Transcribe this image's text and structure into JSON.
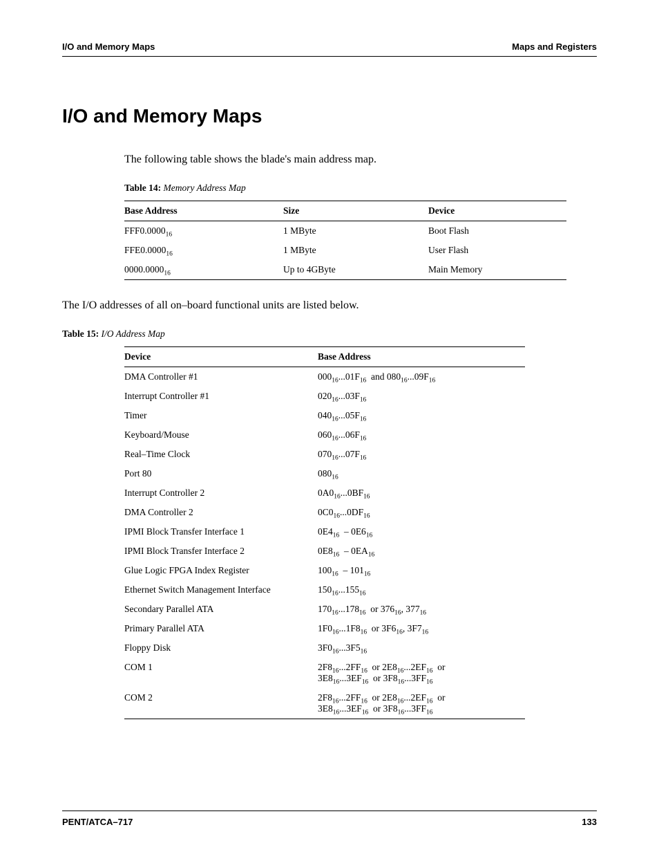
{
  "header": {
    "left": "I/O and Memory Maps",
    "right": "Maps and Registers"
  },
  "title": "I/O and Memory Maps",
  "intro1": "The following table shows the blade's main address map.",
  "table14": {
    "caption_label": "Table 14:",
    "caption_title": " Memory Address Map",
    "headers": {
      "h1": "Base Address",
      "h2": "Size",
      "h3": "Device"
    },
    "rows": [
      {
        "addr_html": "FFF0.0000<sub>16</sub>",
        "size": "1 MByte",
        "device": "Boot Flash"
      },
      {
        "addr_html": "FFE0.0000<sub>16</sub>",
        "size": "1 MByte",
        "device": "User Flash"
      },
      {
        "addr_html": "0000.0000<sub>16</sub>",
        "size": "Up to 4GByte",
        "device": "Main Memory"
      }
    ]
  },
  "intro2": "The I/O addresses of all on–board functional units are listed below.",
  "table15": {
    "caption_label": "Table 15:",
    "caption_title": " I/O Address Map",
    "headers": {
      "h1": "Device",
      "h2": "Base Address"
    },
    "rows": [
      {
        "device": "DMA Controller #1",
        "addr_html": "000<sub>16</sub>...01F<sub>16</sub>&nbsp;&nbsp;and 080<sub>16</sub>...09F<sub>16</sub>"
      },
      {
        "device": "Interrupt Controller #1",
        "addr_html": "020<sub>16</sub>...03F<sub>16</sub>"
      },
      {
        "device": "Timer",
        "addr_html": "040<sub>16</sub>...05F<sub>16</sub>"
      },
      {
        "device": "Keyboard/Mouse",
        "addr_html": "060<sub>16</sub>...06F<sub>16</sub>"
      },
      {
        "device": "Real–Time Clock",
        "addr_html": "070<sub>16</sub>...07F<sub>16</sub>"
      },
      {
        "device": "Port 80",
        "addr_html": "080<sub>16</sub>"
      },
      {
        "device": "Interrupt Controller 2",
        "addr_html": "0A0<sub>16</sub>...0BF<sub>16</sub>"
      },
      {
        "device": "DMA Controller 2",
        "addr_html": "0C0<sub>16</sub>...0DF<sub>16</sub>"
      },
      {
        "device": "IPMI Block Transfer Interface 1",
        "addr_html": "0E4<sub>16</sub>&nbsp;&nbsp;– 0E6<sub>16</sub>"
      },
      {
        "device": "IPMI Block Transfer Interface 2",
        "addr_html": "0E8<sub>16</sub>&nbsp;&nbsp;– 0EA<sub>16</sub>"
      },
      {
        "device": "Glue Logic FPGA Index Register",
        "addr_html": "100<sub>16</sub>&nbsp;&nbsp;– 101<sub>16</sub>"
      },
      {
        "device": "Ethernet Switch Management Interface",
        "addr_html": "150<sub>16</sub>...155<sub>16</sub>"
      },
      {
        "device": "Secondary Parallel ATA",
        "addr_html": "170<sub>16</sub>...178<sub>16</sub>&nbsp;&nbsp;or 376<sub>16</sub>, 377<sub>16</sub>"
      },
      {
        "device": "Primary Parallel ATA",
        "addr_html": "1F0<sub>16</sub>...1F8<sub>16</sub>&nbsp;&nbsp;or 3F6<sub>16</sub>, 3F7<sub>16</sub>"
      },
      {
        "device": "Floppy Disk",
        "addr_html": "3F0<sub>16</sub>...3F5<sub>16</sub>"
      },
      {
        "device": "COM 1",
        "addr_html": "2F8<sub>16</sub>...2FF<sub>16</sub>&nbsp;&nbsp;or 2E8<sub>16</sub>...2EF<sub>16</sub>&nbsp;&nbsp;or<br>3E8<sub>16</sub>...3EF<sub>16</sub>&nbsp;&nbsp;or 3F8<sub>16</sub>...3FF<sub>16</sub>"
      },
      {
        "device": "COM 2",
        "addr_html": "2F8<sub>16</sub>...2FF<sub>16</sub>&nbsp;&nbsp;or 2E8<sub>16</sub>...2EF<sub>16</sub>&nbsp;&nbsp;or<br>3E8<sub>16</sub>...3EF<sub>16</sub>&nbsp;&nbsp;or 3F8<sub>16</sub>...3FF<sub>16</sub>"
      }
    ]
  },
  "footer": {
    "left": "PENT/ATCA–717",
    "right": "133"
  }
}
